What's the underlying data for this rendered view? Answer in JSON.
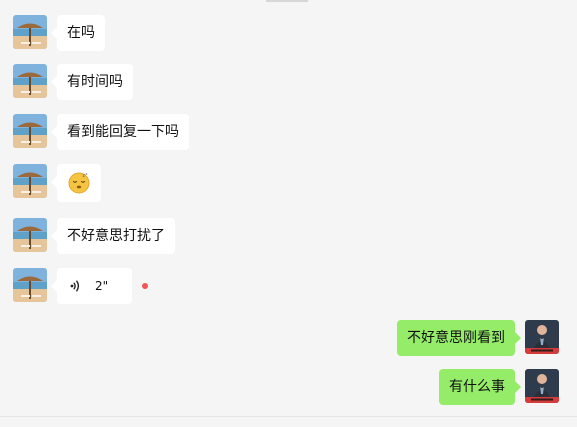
{
  "conversation": {
    "incoming": [
      {
        "type": "text",
        "text": "在吗"
      },
      {
        "type": "text",
        "text": "有时间吗"
      },
      {
        "type": "text",
        "text": "看到能回复一下吗"
      },
      {
        "type": "emoji",
        "emoji_name": "sleeping-face-icon"
      },
      {
        "type": "text",
        "text": "不好意思打扰了"
      },
      {
        "type": "voice",
        "duration": "2\""
      }
    ],
    "outgoing": [
      {
        "type": "text",
        "text": "不好意思刚看到"
      },
      {
        "type": "text",
        "text": "有什么事"
      }
    ]
  },
  "colors": {
    "background": "#f5f5f5",
    "incoming_bubble": "#ffffff",
    "outgoing_bubble": "#95ec69",
    "unread_dot": "#f25555"
  },
  "icons": {
    "incoming_avatar": "beach-umbrella-avatar",
    "outgoing_avatar": "man-in-suit-avatar",
    "voice": "voice-wave-icon",
    "emoji": "sleeping-face-icon"
  }
}
